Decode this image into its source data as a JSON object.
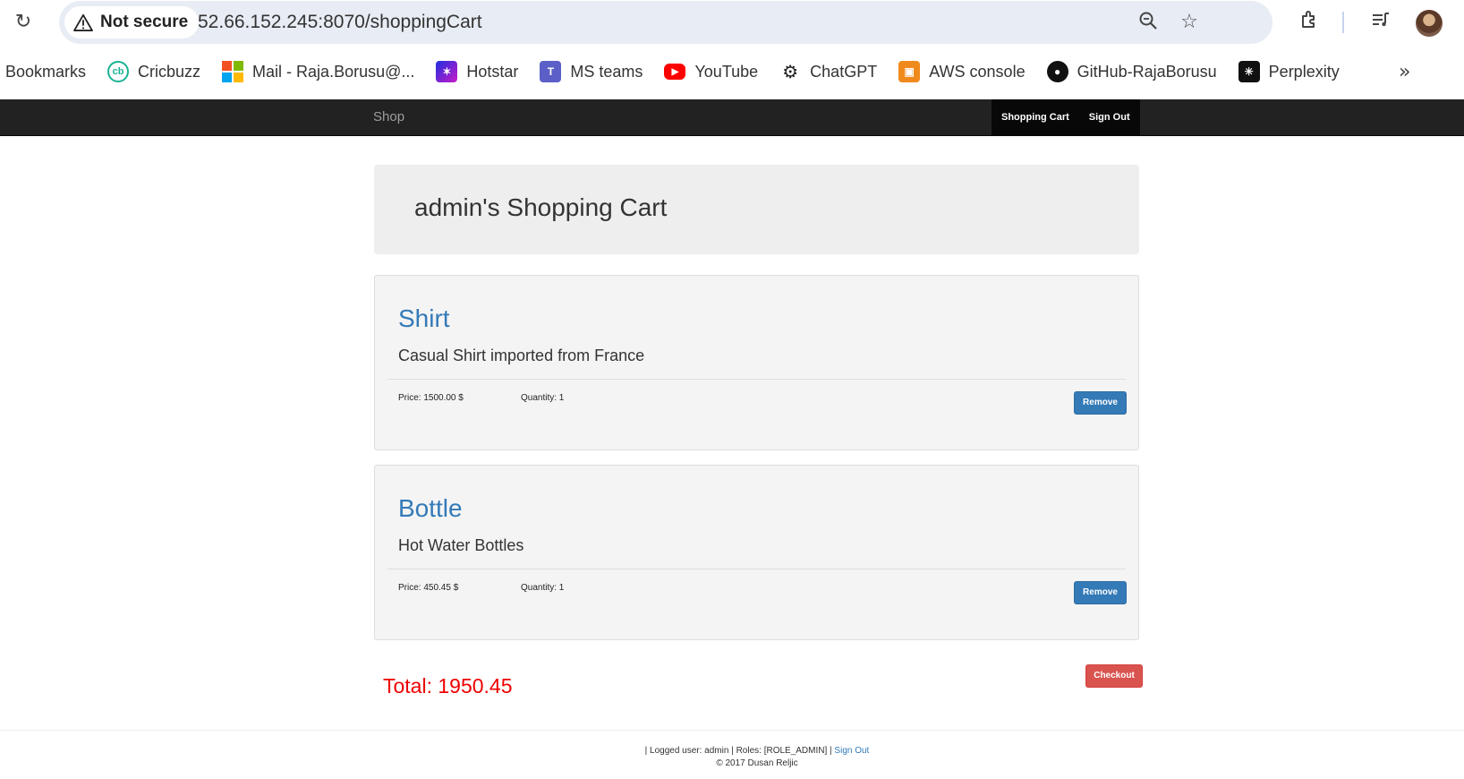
{
  "browser": {
    "security_label": "Not secure",
    "url": "52.66.152.245:8070/shoppingCart",
    "bookmarks": [
      {
        "label": "Bookmarks"
      },
      {
        "label": "Cricbuzz",
        "icon": "cricbuzz-icon",
        "color": "#1ab394"
      },
      {
        "label": "Mail - Raja.Borusu@...",
        "icon": "microsoft-icon"
      },
      {
        "label": "Hotstar",
        "icon": "hotstar-icon",
        "color": "#6a1fd1"
      },
      {
        "label": "MS teams",
        "icon": "teams-icon",
        "color": "#5b5fc7"
      },
      {
        "label": "YouTube",
        "icon": "youtube-icon",
        "color": "#ff0000"
      },
      {
        "label": "ChatGPT",
        "icon": "chatgpt-icon",
        "color": "#222222"
      },
      {
        "label": "AWS console",
        "icon": "aws-icon",
        "color": "#f08a1c"
      },
      {
        "label": "GitHub-RajaBorusu",
        "icon": "github-icon",
        "color": "#111111"
      },
      {
        "label": "Perplexity",
        "icon": "perplexity-icon",
        "color": "#111111"
      }
    ]
  },
  "navbar": {
    "brand": "Shop",
    "links": [
      "Shopping Cart",
      "Sign Out"
    ]
  },
  "cart": {
    "title": "admin's Shopping Cart",
    "items": [
      {
        "name": "Shirt",
        "description": "Casual Shirt imported from France",
        "price": "Price: 1500.00 $",
        "quantity": "Quantity: 1",
        "remove_label": "Remove"
      },
      {
        "name": "Bottle",
        "description": "Hot Water Bottles",
        "price": "Price: 450.45 $",
        "quantity": "Quantity: 1",
        "remove_label": "Remove"
      }
    ],
    "total": "Total: 1950.45",
    "checkout_label": "Checkout"
  },
  "footer": {
    "user_info": "| Logged user: admin | Roles: [ROLE_ADMIN] |",
    "signout_link": "Sign Out",
    "copyright": "© 2017 Dusan Reljic"
  },
  "colors": {
    "link": "#337ab7",
    "danger": "#d9534f",
    "total": "#ee0000",
    "navbar": "#222222"
  }
}
